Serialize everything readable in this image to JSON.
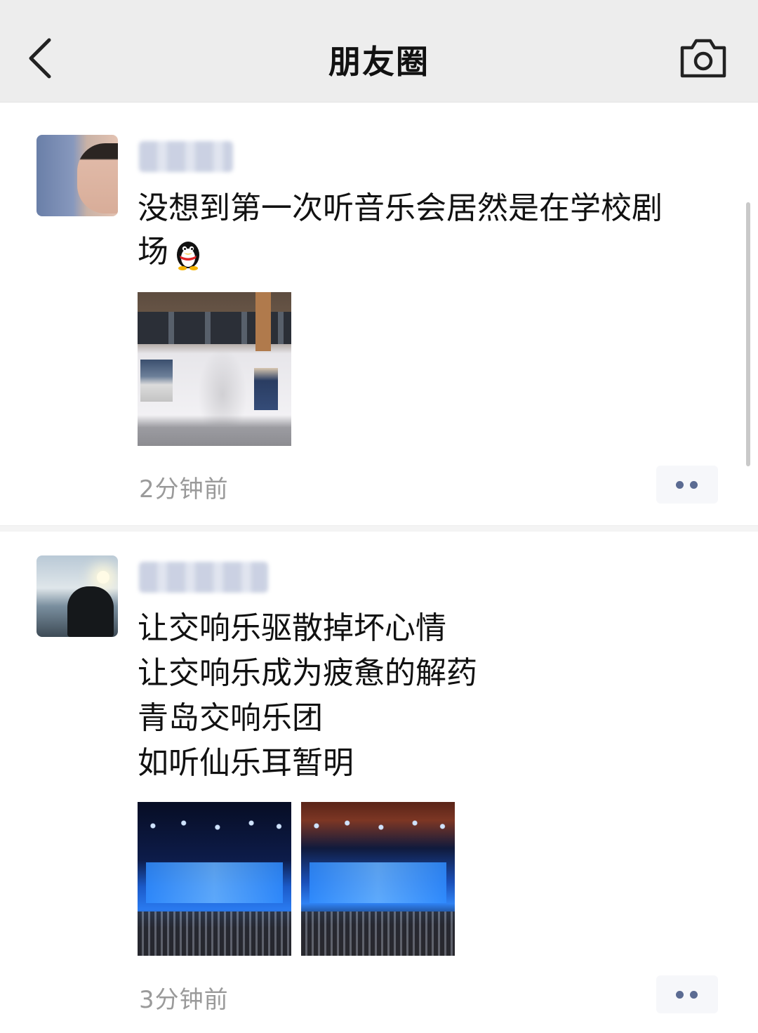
{
  "nav": {
    "title": "朋友圈",
    "back_icon": "chevron-left-icon",
    "camera_icon": "camera-icon"
  },
  "posts": [
    {
      "text": "没想到第一次听音乐会居然是在学校剧\n场",
      "emoji": "penguin-emoji",
      "image_count": 1,
      "time": "2分钟前"
    },
    {
      "text": "让交响乐驱散掉坏心情\n让交响乐成为疲惫的解药\n青岛交响乐团\n如听仙乐耳暂明",
      "image_count": 2,
      "time": "3分钟前"
    }
  ],
  "colors": {
    "nav_bg": "#ededed",
    "time_text": "#9a9a9a",
    "more_dots": "#5b6b92"
  }
}
